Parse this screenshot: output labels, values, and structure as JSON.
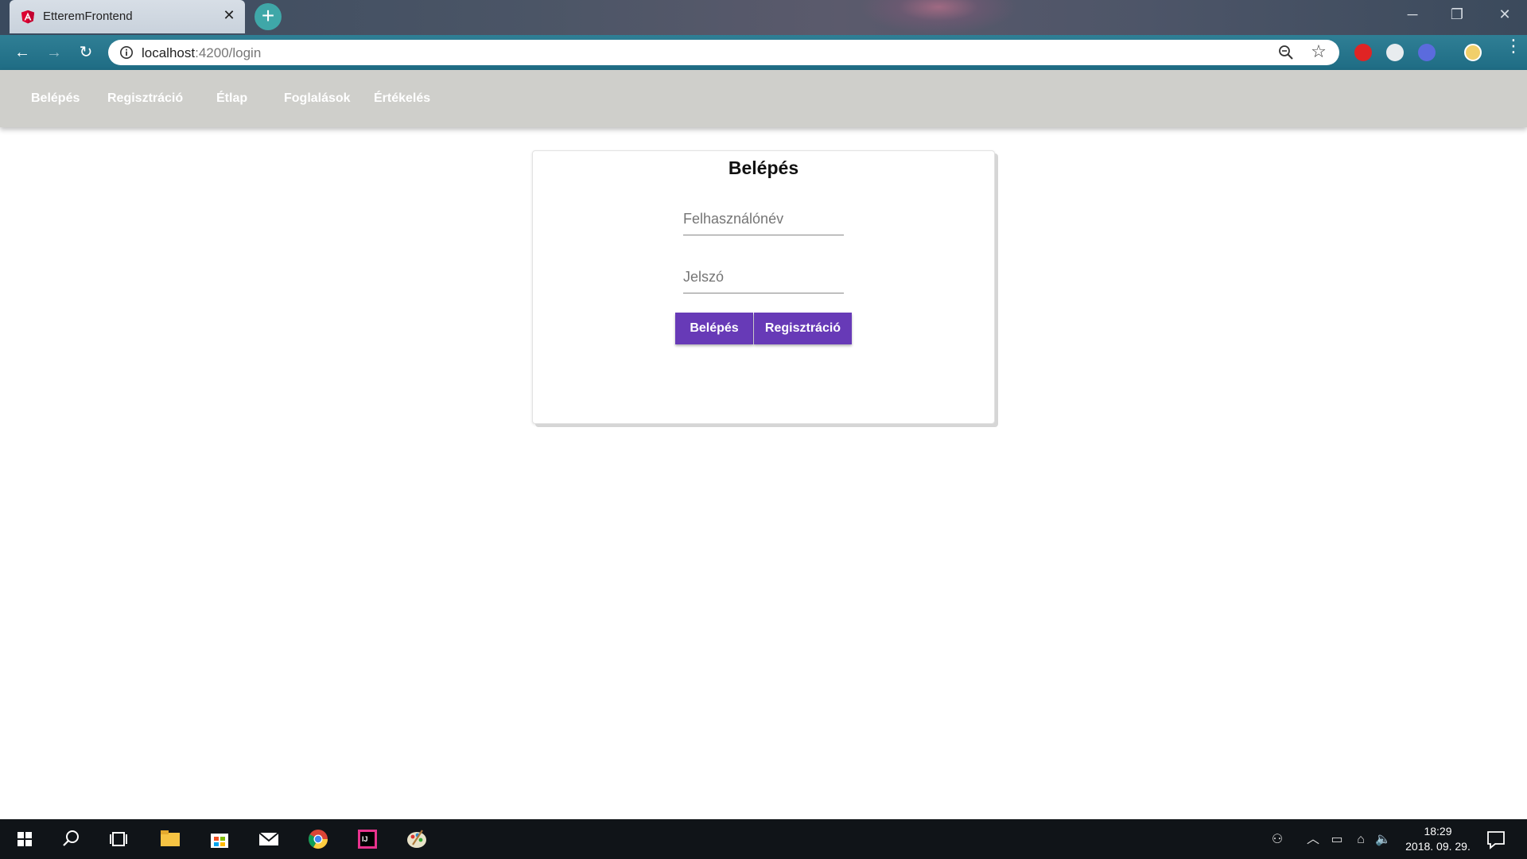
{
  "browser": {
    "tab_title": "EtteremFrontend",
    "url_host": "localhost",
    "url_path": ":4200/login",
    "new_tab_label": "+",
    "close_tab_label": "✕"
  },
  "nav": {
    "items": [
      {
        "label": "Belépés"
      },
      {
        "label": "Regisztráció"
      },
      {
        "label": "Étlap"
      },
      {
        "label": "Foglalások"
      },
      {
        "label": "Értékelés"
      }
    ]
  },
  "login": {
    "title": "Belépés",
    "username_placeholder": "Felhasználónév",
    "username_value": "",
    "password_placeholder": "Jelszó",
    "password_value": "",
    "login_button": "Belépés",
    "register_button": "Regisztráció"
  },
  "taskbar": {
    "time": "18:29",
    "date": "2018. 09. 29."
  },
  "colors": {
    "accent": "#673ab7",
    "nav_bg": "#cfcfcb",
    "browser_toolbar": "#1f6c84"
  }
}
